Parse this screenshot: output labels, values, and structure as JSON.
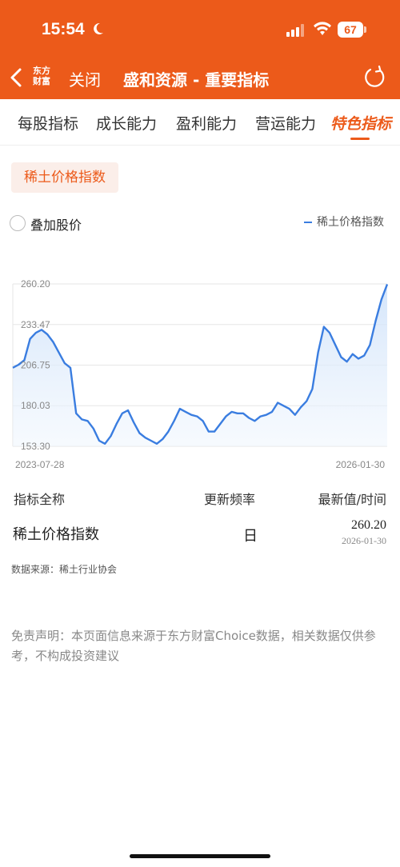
{
  "status": {
    "time": "15:54",
    "battery": "67"
  },
  "nav": {
    "logo_line1": "东方",
    "logo_line2": "财富",
    "close_label": "关闭",
    "title": "盛和资源 - 重要指标"
  },
  "tabs": [
    {
      "label": "每股指标",
      "active": false
    },
    {
      "label": "成长能力",
      "active": false
    },
    {
      "label": "盈利能力",
      "active": false
    },
    {
      "label": "营运能力",
      "active": false
    },
    {
      "label": "特色指标",
      "active": true
    }
  ],
  "chip_label": "稀土价格指数",
  "overlay_label": "叠加股价",
  "legend_label": "稀土价格指数",
  "colors": {
    "accent": "#ec5a1a",
    "line": "#3a7de0",
    "fill": "#dbe9fb"
  },
  "chart_data": {
    "type": "area",
    "x_start": "2023-07-28",
    "x_end": "2026-01-30",
    "y_ticks": [
      "260.20",
      "233.47",
      "206.75",
      "180.03",
      "153.30"
    ],
    "ylim": [
      153.3,
      260.2
    ],
    "grid": true,
    "series": [
      {
        "name": "稀土价格指数",
        "values": [
          205,
          207,
          210,
          224,
          228,
          230,
          227,
          222,
          215,
          208,
          205,
          175,
          171,
          170,
          165,
          157,
          155,
          160,
          168,
          175,
          177,
          169,
          162,
          159,
          157,
          155,
          158,
          163,
          170,
          178,
          176,
          174,
          173,
          170,
          163,
          163,
          168,
          173,
          176,
          175,
          175,
          172,
          170,
          173,
          174,
          176,
          182,
          180,
          178,
          174,
          179,
          183,
          191,
          215,
          232,
          228,
          220,
          212,
          209,
          214,
          211,
          213,
          220,
          236,
          250,
          260
        ]
      }
    ]
  },
  "table": {
    "headers": [
      "指标全称",
      "更新频率",
      "最新值/时间"
    ],
    "row": {
      "name": "稀土价格指数",
      "frequency": "日",
      "value": "260.20",
      "date": "2026-01-30"
    }
  },
  "source": "数据来源：稀土行业协会",
  "disclaimer": "免责声明：本页面信息来源于东方财富Choice数据，相关数据仅供参考，不构成投资建议"
}
